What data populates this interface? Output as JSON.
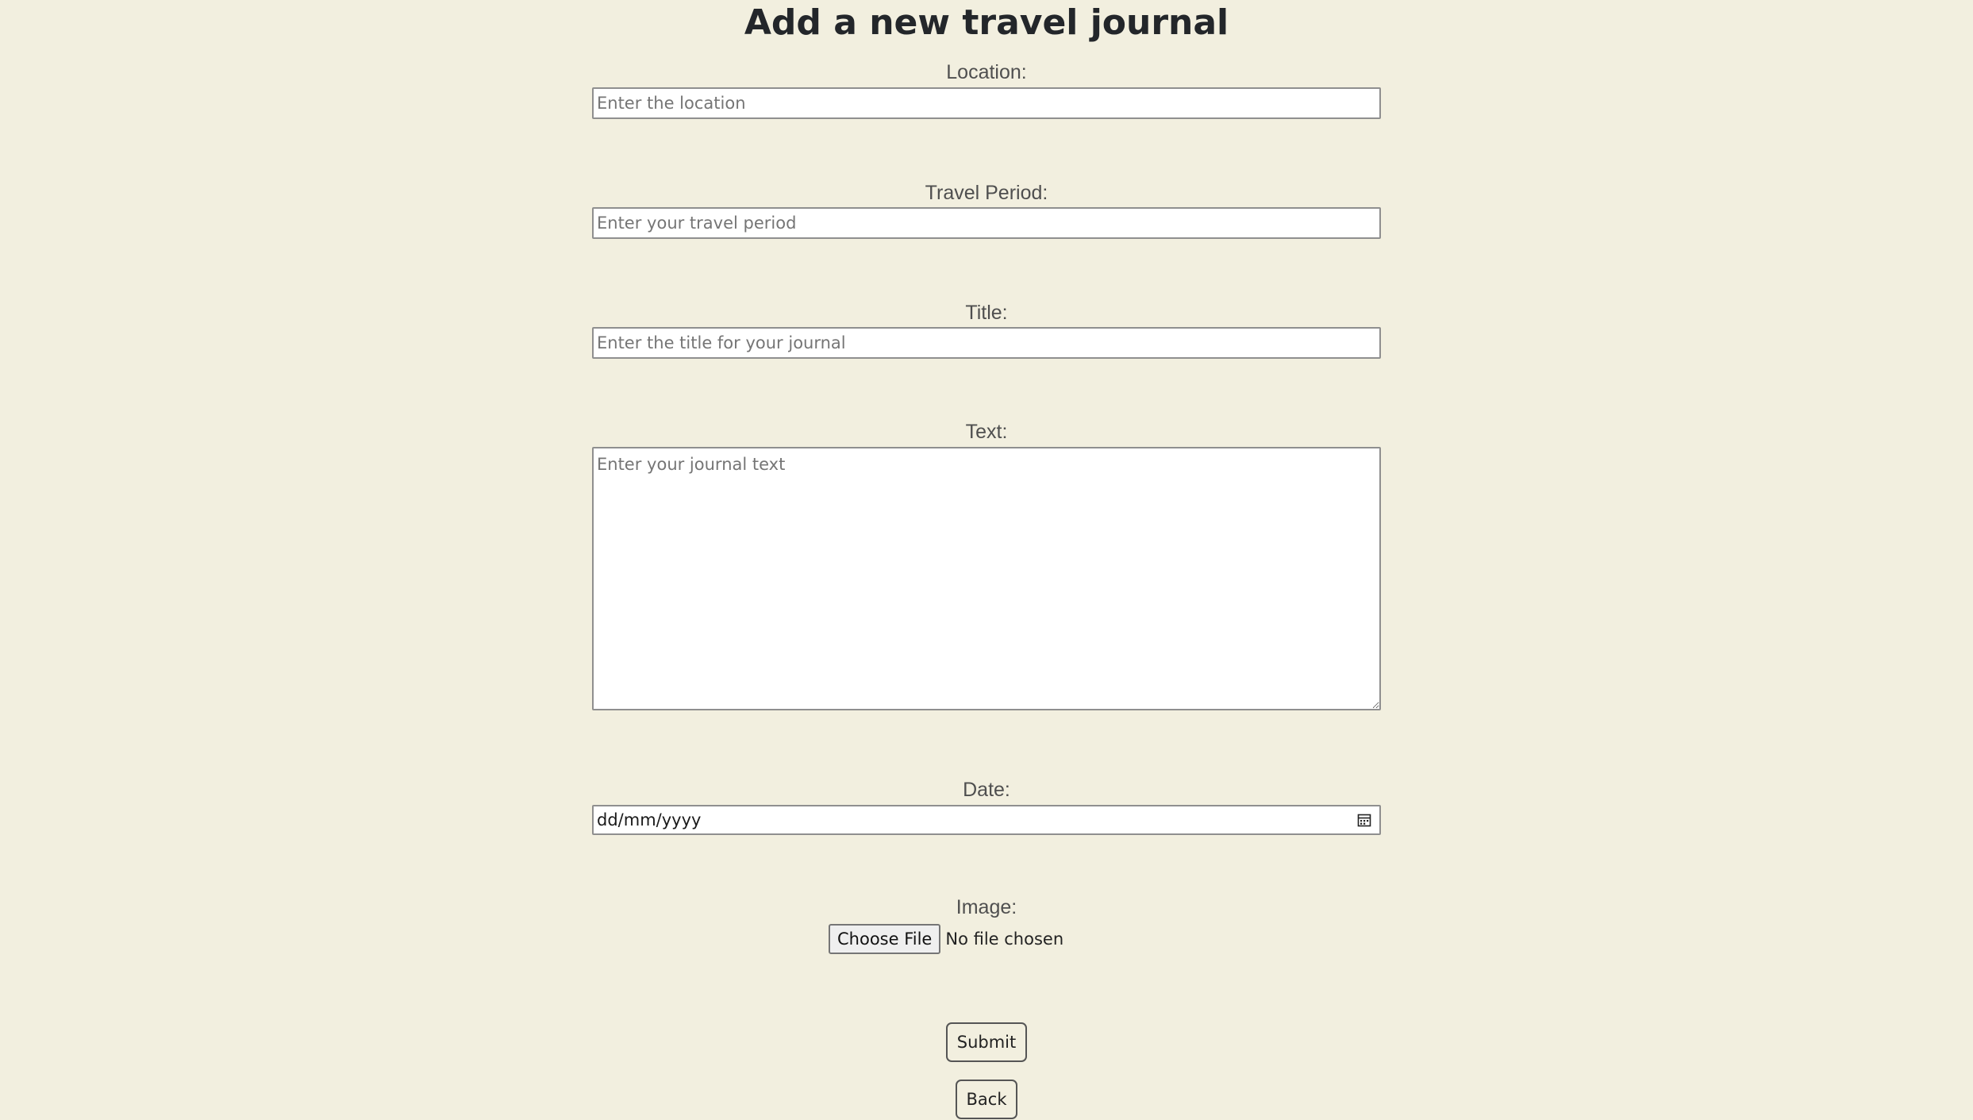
{
  "page": {
    "title": "Add a new travel journal"
  },
  "form": {
    "location": {
      "label": "Location:",
      "placeholder": "Enter the location",
      "value": ""
    },
    "travel_period": {
      "label": "Travel Period:",
      "placeholder": "Enter your travel period",
      "value": ""
    },
    "title": {
      "label": "Title:",
      "placeholder": "Enter the title for your journal",
      "value": ""
    },
    "text": {
      "label": "Text:",
      "placeholder": "Enter your journal text",
      "value": ""
    },
    "date": {
      "label": "Date:",
      "display": "dd/mm/yyyy",
      "icon": "calendar-icon"
    },
    "image": {
      "label": "Image:",
      "button_label": "Choose File",
      "status": "No file chosen"
    },
    "submit_label": "Submit",
    "back_label": "Back"
  }
}
